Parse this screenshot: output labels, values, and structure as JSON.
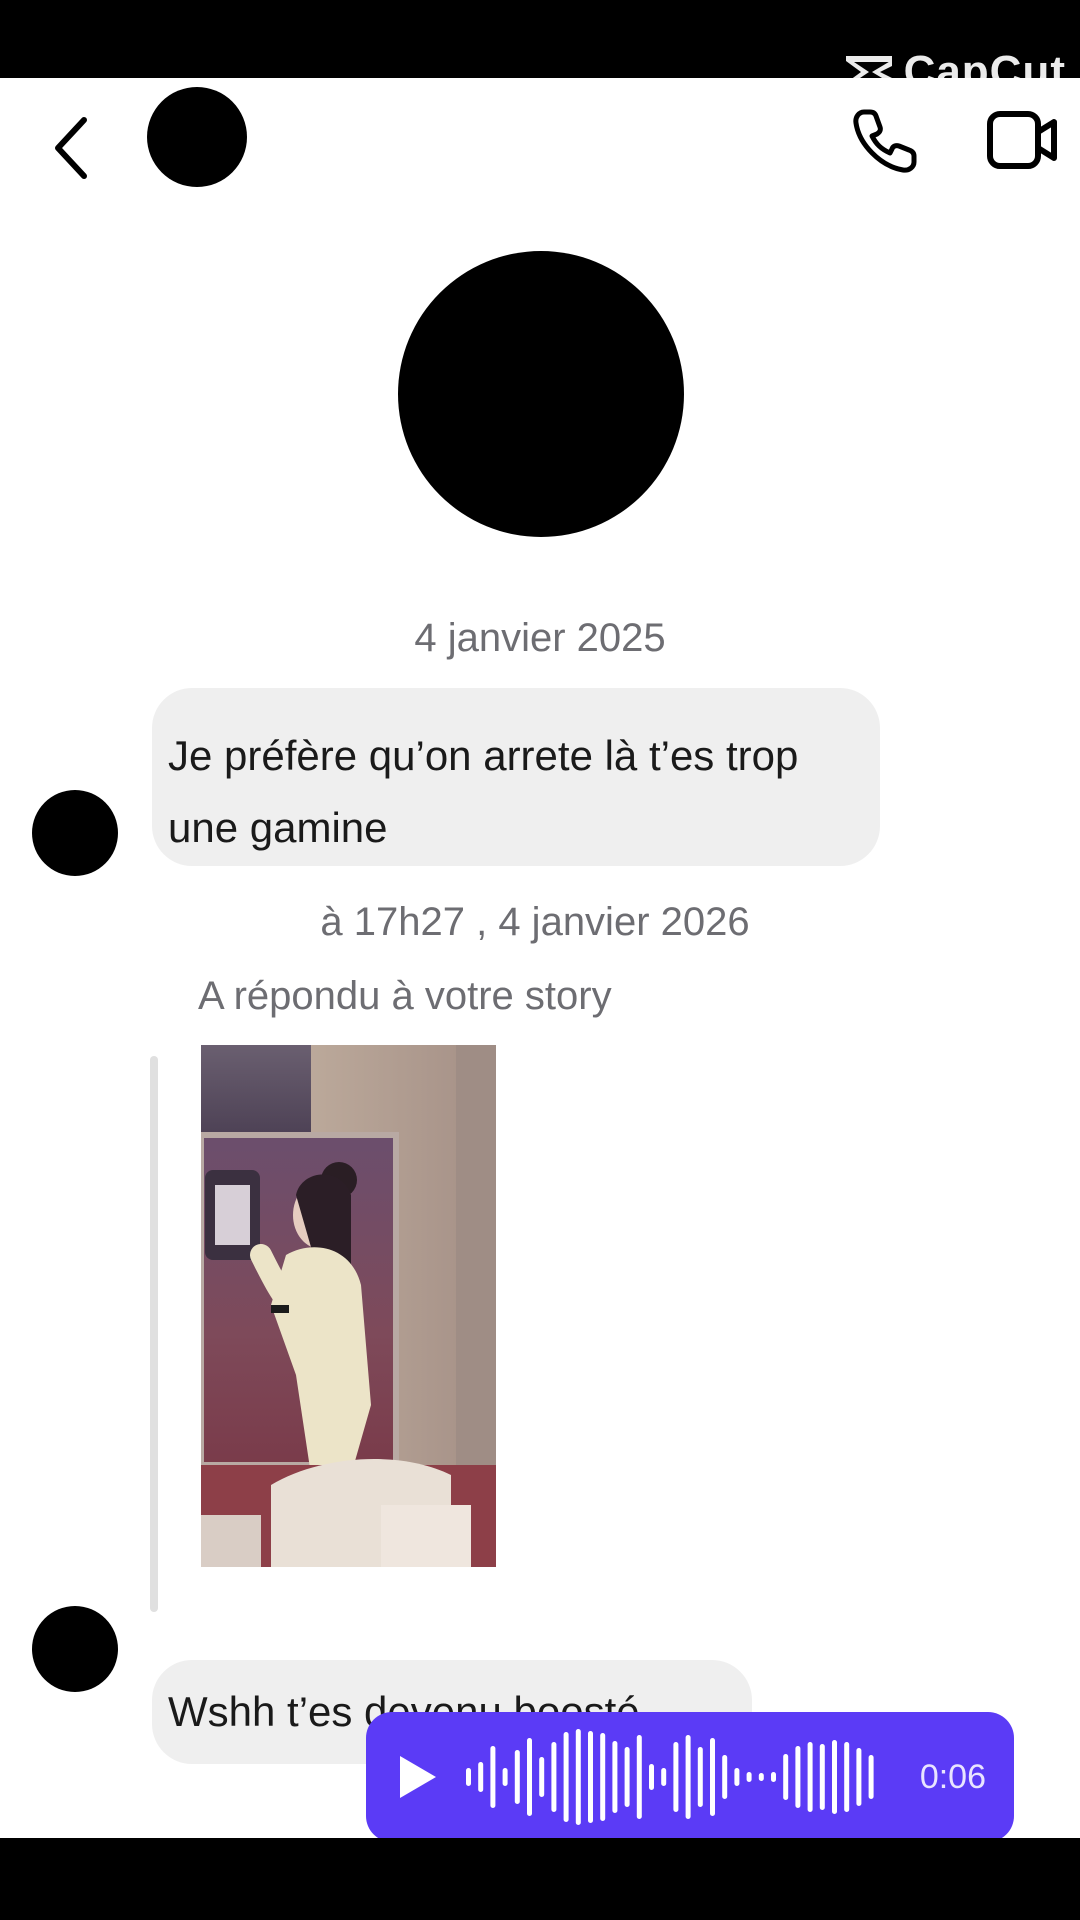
{
  "watermark": {
    "label": "CapCut"
  },
  "header": {
    "back_icon": "chevron-left-icon",
    "call_icon": "phone-icon",
    "video_icon": "video-camera-icon"
  },
  "conversation": {
    "date_1": "4 janvier 2025",
    "message_1": "Je préfère qu’on arrete là t’es trop une gamine",
    "date_2": "à 17h27 , 4 janvier 2026",
    "reply_note": "A répondu à votre story",
    "message_2": "Wshh t’es devenu boosté",
    "voice": {
      "duration": "0:06",
      "play_icon": "play-icon",
      "color": "#5b3bf6"
    }
  }
}
